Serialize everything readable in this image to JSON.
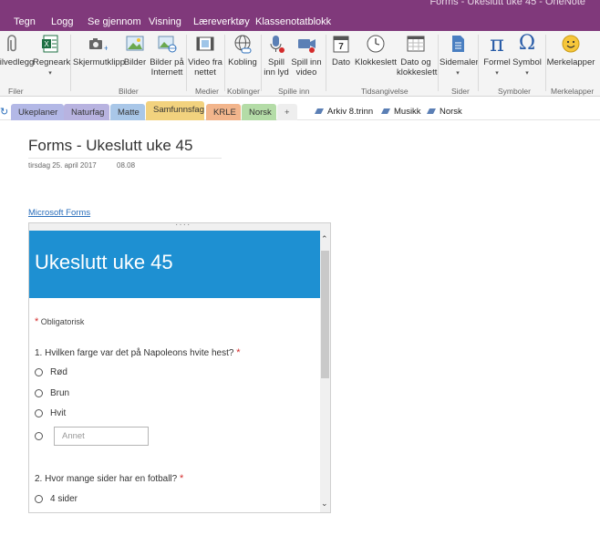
{
  "window": {
    "title": "Forms - Ukeslutt uke 45 - OneNote"
  },
  "menu": {
    "tabs": [
      "Tegn",
      "Logg",
      "Se gjennom",
      "Visning",
      "Læreverktøy",
      "Klassenotatblokk"
    ]
  },
  "ribbon": {
    "buttons": [
      {
        "label": "Filvedlegg",
        "icon": "paperclip-icon"
      },
      {
        "label": "Regneark",
        "icon": "excel-icon"
      },
      {
        "label": "Skjermutklipp",
        "icon": "camera-icon"
      },
      {
        "label": "Bilder",
        "icon": "picture-icon"
      },
      {
        "label": "Bilder på",
        "label2": "Internett",
        "icon": "online-picture-icon"
      },
      {
        "label": "Video fra",
        "label2": "nettet",
        "icon": "video-icon"
      },
      {
        "label": "Kobling",
        "icon": "link-icon"
      },
      {
        "label": "Spill",
        "label2": "inn lyd",
        "icon": "microphone-icon"
      },
      {
        "label": "Spill inn",
        "label2": "video",
        "icon": "video-camera-icon"
      },
      {
        "label": "Dato",
        "icon": "calendar-icon",
        "day": "7"
      },
      {
        "label": "Klokkeslett",
        "icon": "clock-icon"
      },
      {
        "label": "Dato og",
        "label2": "klokkeslett",
        "icon": "calendar-clock-icon"
      },
      {
        "label": "Sidemaler",
        "icon": "page-template-icon"
      },
      {
        "label": "Formel",
        "icon": "pi-icon",
        "glyph": "π"
      },
      {
        "label": "Symbol",
        "icon": "omega-icon",
        "glyph": "Ω"
      },
      {
        "label": "Merkelapper",
        "icon": "smiley-icon"
      }
    ],
    "groups": [
      "Filer",
      "Bilder",
      "Medier",
      "Koblinger",
      "Spille inn",
      "Tidsangivelse",
      "Sider",
      "Symboler",
      "Merkelapper"
    ]
  },
  "sections": {
    "tabs": [
      {
        "label": "Ukeplaner",
        "color": "#b3b8e6"
      },
      {
        "label": "Naturfag",
        "color": "#b8b3e0"
      },
      {
        "label": "Matte",
        "color": "#a9c7e8"
      },
      {
        "label": "Samfunnsfag",
        "color": "#f2d27e"
      },
      {
        "label": "KRLE",
        "color": "#f2b58c"
      },
      {
        "label": "Norsk",
        "color": "#b4dca7"
      }
    ],
    "add_label": "+",
    "page_links": [
      "Arkiv 8.trinn",
      "Musikk",
      "Norsk"
    ]
  },
  "page": {
    "title": "Forms - Ukeslutt uke 45",
    "date": "tirsdag 25. april 2017",
    "time": "08.08",
    "link": "Microsoft Forms"
  },
  "form": {
    "header_color": "#1e90d2",
    "title": "Ukeslutt uke 45",
    "required_star": "*",
    "required_label": "Obligatorisk",
    "q1": "1. Hvilken farge var det på Napoleons hvite hest?",
    "q1_options": [
      "Rød",
      "Brun",
      "Hvit"
    ],
    "q1_other_placeholder": "Annet",
    "q2": "2. Hvor mange sider har en fotball?",
    "q2_options": [
      "4 sider"
    ]
  }
}
